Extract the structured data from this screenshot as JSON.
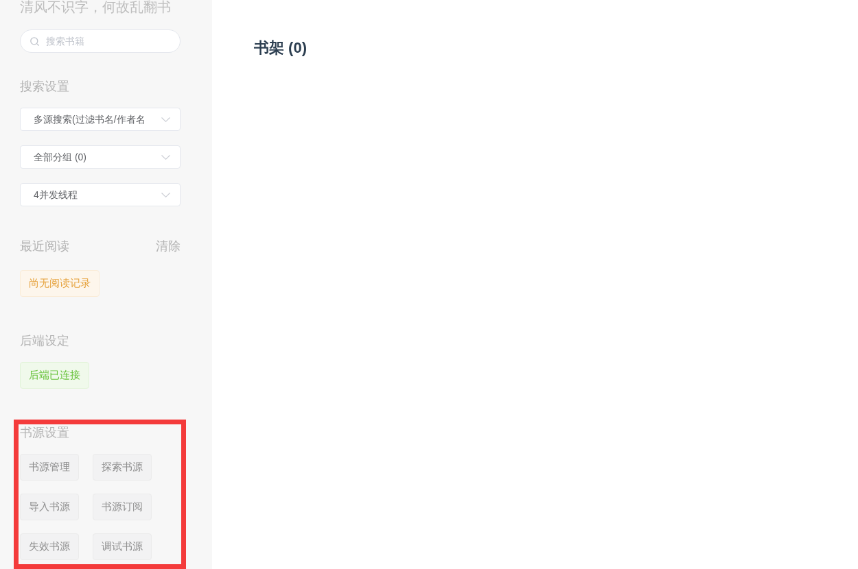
{
  "sidebar": {
    "motto": "清风不识字，何故乱翻书",
    "search": {
      "placeholder": "搜索书籍"
    },
    "search_settings": {
      "title": "搜索设置",
      "selects": [
        {
          "value": "多源搜索(过滤书名/作者名"
        },
        {
          "value": "全部分组 (0)"
        },
        {
          "value": "4并发线程"
        }
      ]
    },
    "recent_reading": {
      "title": "最近阅读",
      "clear_link": "清除",
      "tags": [
        {
          "label": "尚无阅读记录",
          "kind": "warning"
        }
      ]
    },
    "backend": {
      "title": "后端设定",
      "tags": [
        {
          "label": "后端已连接",
          "kind": "success"
        }
      ]
    },
    "source_settings": {
      "title": "书源设置",
      "highlighted": true,
      "buttons": [
        "书源管理",
        "探索书源",
        "导入书源",
        "书源订阅",
        "失效书源",
        "调试书源"
      ]
    }
  },
  "main": {
    "title": "书架 (0)"
  }
}
